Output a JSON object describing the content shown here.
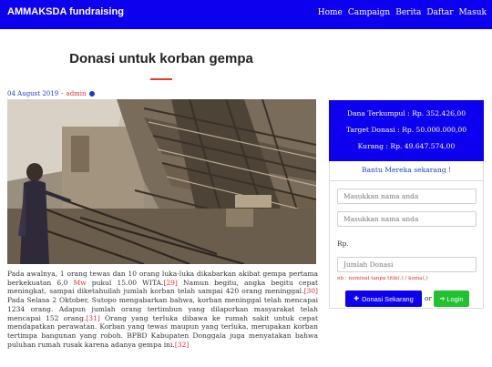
{
  "navbar": {
    "brand": "AMMAKSDA fundraising",
    "links": [
      "Home",
      "Campaign",
      "Berita",
      "Daftar",
      "Masuk"
    ]
  },
  "page": {
    "title": "Donasi untuk korban gempa"
  },
  "meta": {
    "date": "04 August 2019",
    "separator": "-",
    "author": "admin"
  },
  "article": {
    "p1": "Pada awalnya, 1 orang tewas dan 10 orang luka-luka dikabarkan akibat gempa pertama berkekuatan 6,0 ",
    "magnitude_unit": "Mw",
    "p2": " pukul 15.00 WITA.",
    "ref1": "[29]",
    "p3": " Namun begitu, angka begitu cepat meningkat, sampai diketahuilah jumlah korban telah sampai 420 orang meninggal.",
    "ref2": "[30]",
    "p4": " Pada Selasa 2 Oktober, Sutopo mengabarkan bahwa, korban meninggal telah mencapai 1234 orang. Adapun jumlah orang tertimbun yang dilaporkan masyarakat telah mencapai 152 orang.",
    "ref3": "[31]",
    "p5": " Orang yang terluka dibawa ke rumah sakit untuk cepat mendapatkan perawatan. Korban yang tewas maupun yang terluka, merupakan korban tertimpa bangunan yang roboh. BPBD Kabupaten Donggala juga menyatakan bahwa puluhan rumah rusak karena adanya gempa ini.",
    "ref4": "[32]"
  },
  "donation": {
    "collected": "Dana Terkumpul : Rp. 352.426,00",
    "target": "Target Donasi : Rp. 50.000.000,00",
    "remaining": "Kurang : Rp. 49.647.574,00",
    "appeal": "Bantu Mereka sekarang !"
  },
  "form": {
    "name_placeholder_1": "Masukkan nama anda",
    "name_placeholder_2": "Masukkan nama anda",
    "currency_label": "Rp.",
    "amount_placeholder": "Jumlah Donasi",
    "note": "nb : nominal tanpa titik(.) / koma(,)",
    "donate_label": "Donasi Sekarang",
    "or_label": "or",
    "login_label": "Login"
  },
  "colors": {
    "primary": "#0d00ee",
    "accent": "#e0401e",
    "success": "#22c130",
    "link_red": "#e03030"
  },
  "icons": {
    "verified": "check-badge-icon",
    "donate": "user-plus-icon",
    "login": "sign-in-icon"
  }
}
